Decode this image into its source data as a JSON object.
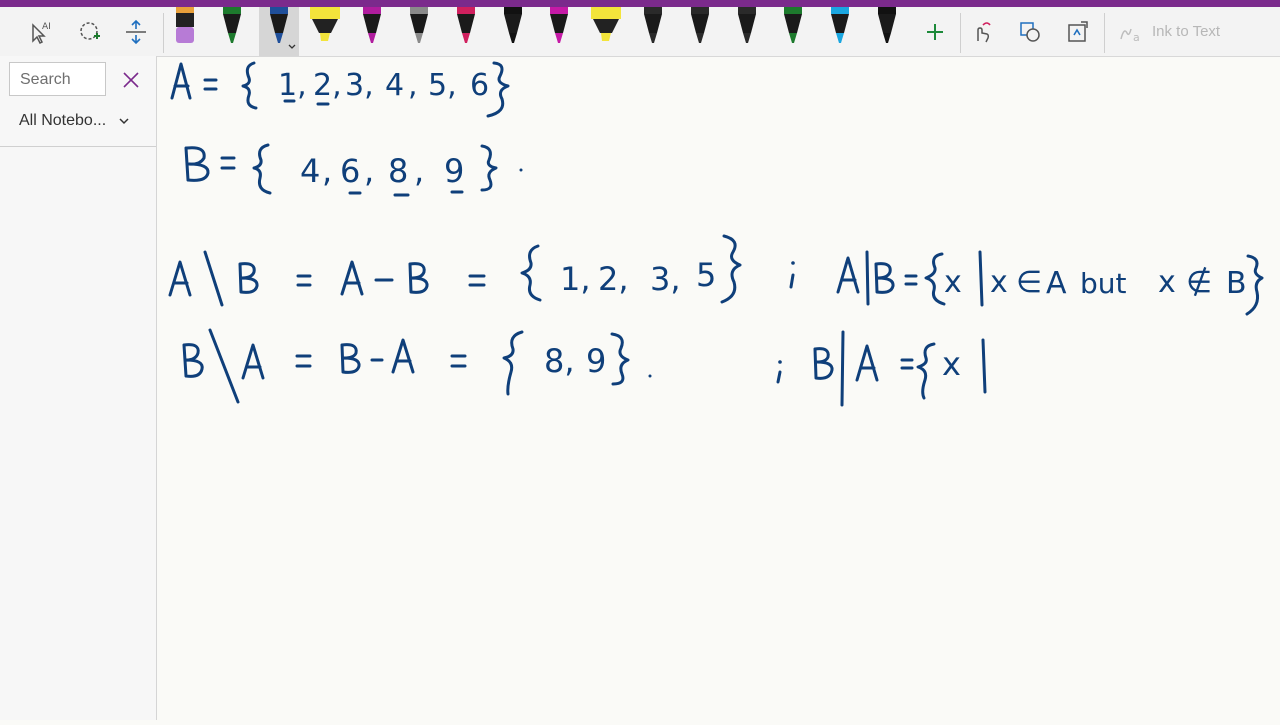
{
  "toolbar": {
    "tools": [
      "lasso-select-icon",
      "lasso-icon",
      "add-space-icon"
    ],
    "pens": [
      {
        "name": "eraser-pen",
        "color": "#b77bd6",
        "cap": "#e8a03b"
      },
      {
        "name": "pen-green",
        "color": "#1d7a2d"
      },
      {
        "name": "pen-navy",
        "color": "#1f4f9a",
        "selected": true
      },
      {
        "name": "highlighter-yellow",
        "color": "#f3e43b",
        "cap": "#f3e43b"
      },
      {
        "name": "pen-purple",
        "color": "#b01d9e"
      },
      {
        "name": "pen-gray-pattern",
        "color": "#8a8a8a"
      },
      {
        "name": "pen-crimson",
        "color": "#d0205e"
      },
      {
        "name": "pen-black",
        "color": "#111111"
      },
      {
        "name": "pen-magenta",
        "color": "#c51aa6"
      },
      {
        "name": "highlighter-yellow-2",
        "color": "#f3e43b",
        "cap": "#f3e43b"
      },
      {
        "name": "pen-dark",
        "color": "#2a2a2a"
      },
      {
        "name": "pen-dark-2",
        "color": "#2a2a2a"
      },
      {
        "name": "pen-dark-3",
        "color": "#2a2a2a"
      },
      {
        "name": "pen-green-2",
        "color": "#1d7a2d"
      },
      {
        "name": "pen-cyan",
        "color": "#1aa6e0"
      },
      {
        "name": "pen-black-2",
        "color": "#111111"
      }
    ],
    "add_pen_icon": "plus-icon",
    "right_tools": [
      "touch-drawing-icon",
      "ink-to-shape-icon",
      "ink-to-math-icon"
    ],
    "ink_to_text_label": "Ink to Text"
  },
  "sidebar": {
    "search_placeholder": "Search",
    "scope_label": "All Notebo...",
    "close_icon": "close-icon"
  },
  "colors": {
    "accent": "#7b2a8c",
    "ink": "#0f3f7a"
  }
}
